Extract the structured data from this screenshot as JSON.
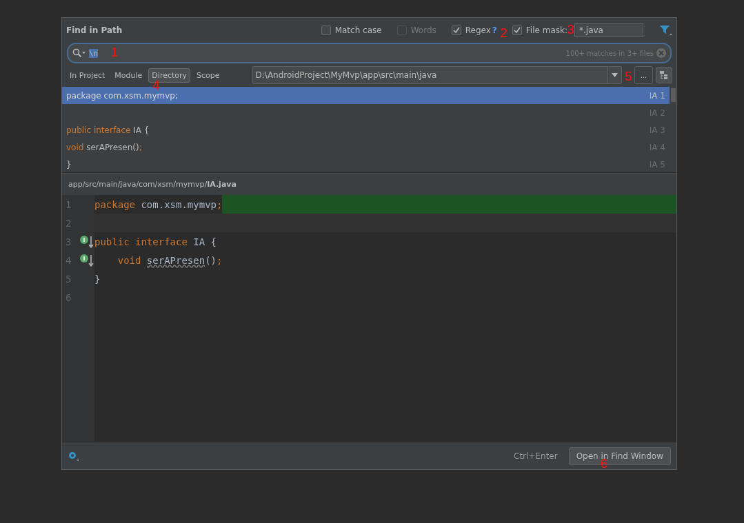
{
  "dialog": {
    "title": "Find in Path"
  },
  "options": [
    {
      "label": "Match case",
      "checked": false,
      "disabled": false
    },
    {
      "label": "Words",
      "checked": false,
      "disabled": true
    },
    {
      "label": "Regex",
      "checked": true,
      "disabled": false,
      "help": "?",
      "annotation": "2"
    },
    {
      "label": "File mask:",
      "checked": true,
      "disabled": false,
      "annotation": "3"
    }
  ],
  "file_mask": {
    "value": "*.java"
  },
  "search": {
    "value": "\\n",
    "text_selected": true,
    "annotation": "1",
    "match_count": "100+ matches in 3+ files"
  },
  "scope_tabs": [
    {
      "label": "In Project",
      "selected": false
    },
    {
      "label": "Module",
      "selected": false
    },
    {
      "label": "Directory",
      "selected": true,
      "annotation": "4"
    },
    {
      "label": "Scope",
      "selected": false
    }
  ],
  "directory": {
    "value": "D:\\AndroidProject\\MyMvp\\app\\src\\main\\java",
    "browse_label": "...",
    "browse_annotation": "5"
  },
  "results": [
    {
      "selected": true,
      "location": "IA 1",
      "tokens": [
        {
          "kind": "keyword",
          "text": "package "
        },
        {
          "kind": "plain",
          "text": "com.xsm.mymvp"
        },
        {
          "kind": "keyword",
          "text": ";"
        }
      ]
    },
    {
      "selected": false,
      "location": "IA 2"
    },
    {
      "selected": false,
      "location": "IA 3",
      "tokens": [
        {
          "kind": "keyword",
          "text": "public interface "
        },
        {
          "kind": "plain",
          "text": "IA {"
        }
      ]
    },
    {
      "selected": false,
      "location": "IA 4",
      "tokens": [
        {
          "kind": "keyword",
          "text": "void "
        },
        {
          "kind": "plain",
          "text": "serAPresen()"
        },
        {
          "kind": "keyword",
          "text": ";"
        }
      ]
    },
    {
      "selected": false,
      "location": "IA 5",
      "tokens": [
        {
          "kind": "plain",
          "text": "}"
        }
      ]
    }
  ],
  "preview": {
    "path": "app/src/main/java/com/xsm/mymvp/**IA.java**"
  },
  "editor": {
    "lines": [
      {
        "number": "1",
        "kind": "match",
        "marker": false,
        "tokens": [
          {
            "kind": "keyword",
            "text": "package "
          },
          {
            "kind": "plain",
            "text": "com.xsm.mymvp"
          },
          {
            "kind": "keyword",
            "text": ";"
          }
        ]
      },
      {
        "number": "2",
        "kind": "caret",
        "marker": false
      },
      {
        "number": "3",
        "kind": "plain",
        "marker": true,
        "tokens": [
          {
            "kind": "keyword",
            "text": "public interface "
          },
          {
            "kind": "plain",
            "text": "IA "
          },
          {
            "kind": "brace",
            "text": "{"
          }
        ],
        "children": [
          {
            "number": "4",
            "kind": "plain",
            "marker": true,
            "tokens": [
              {
                "kind": "keyword",
                "text": "void "
              },
              {
                "kind": "unused",
                "text": "serAPresen"
              },
              {
                "kind": "brace",
                "text": "()"
              },
              {
                "kind": "keyword",
                "text": ";"
              }
            ]
          }
        ]
      },
      {
        "number": "5",
        "kind": "plain",
        "marker": false,
        "tokens": [
          {
            "kind": "brace",
            "text": "}"
          }
        ]
      },
      {
        "number": "6",
        "kind": "plain",
        "marker": false
      }
    ]
  },
  "footer": {
    "shortcut": "Ctrl+Enter",
    "button": "Open in Find Window",
    "annotation": "6"
  }
}
